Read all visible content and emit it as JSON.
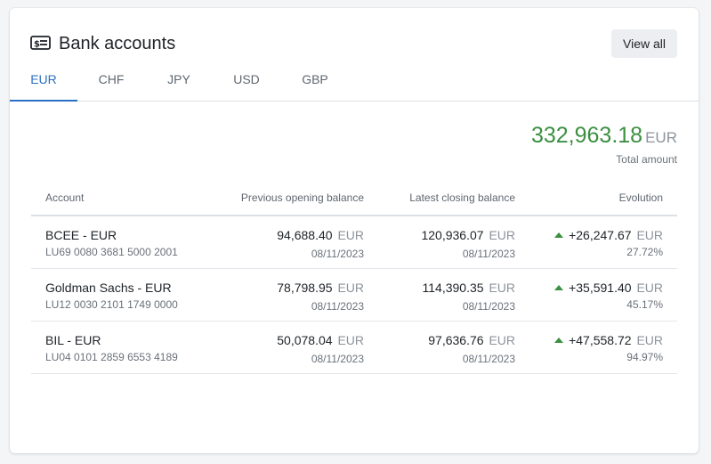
{
  "header": {
    "title": "Bank accounts",
    "view_all_label": "View all"
  },
  "tabs": [
    {
      "label": "EUR",
      "active": true
    },
    {
      "label": "CHF",
      "active": false
    },
    {
      "label": "JPY",
      "active": false
    },
    {
      "label": "USD",
      "active": false
    },
    {
      "label": "GBP",
      "active": false
    }
  ],
  "total": {
    "value": "332,963.18",
    "currency": "EUR",
    "label": "Total amount"
  },
  "table": {
    "columns": {
      "account": "Account",
      "previous": "Previous opening balance",
      "latest": "Latest closing balance",
      "evolution": "Evolution"
    },
    "rows": [
      {
        "name": "BCEE - EUR",
        "iban": "LU69 0080 3681 5000 2001",
        "previous": "94,688.40",
        "previous_currency": "EUR",
        "previous_date": "08/11/2023",
        "latest": "120,936.07",
        "latest_currency": "EUR",
        "latest_date": "08/11/2023",
        "evolution": "+26,247.67",
        "evolution_currency": "EUR",
        "evolution_pct": "27.72%"
      },
      {
        "name": "Goldman Sachs - EUR",
        "iban": "LU12 0030 2101 1749 0000",
        "previous": "78,798.95",
        "previous_currency": "EUR",
        "previous_date": "08/11/2023",
        "latest": "114,390.35",
        "latest_currency": "EUR",
        "latest_date": "08/11/2023",
        "evolution": "+35,591.40",
        "evolution_currency": "EUR",
        "evolution_pct": "45.17%"
      },
      {
        "name": "BIL - EUR",
        "iban": "LU04 0101 2859 6553 4189",
        "previous": "50,078.04",
        "previous_currency": "EUR",
        "previous_date": "08/11/2023",
        "latest": "97,636.76",
        "latest_currency": "EUR",
        "latest_date": "08/11/2023",
        "evolution": "+47,558.72",
        "evolution_currency": "EUR",
        "evolution_pct": "94.97%"
      }
    ]
  },
  "colors": {
    "accent": "#2b6fc2",
    "positive": "#3c8f41"
  },
  "icons": {
    "title": "bank-card-icon",
    "trend": "arrow-up-icon"
  }
}
